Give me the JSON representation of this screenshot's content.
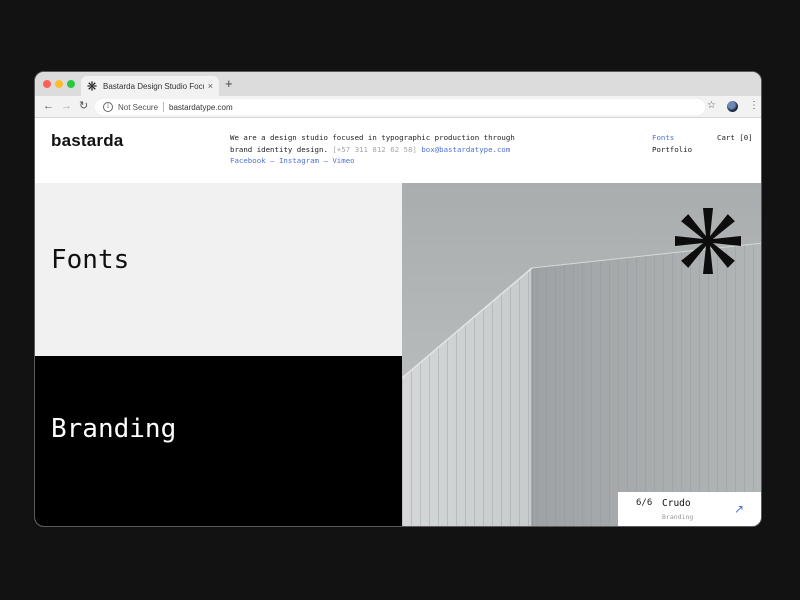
{
  "browser": {
    "tab_title": "Bastarda Design Studio Focus",
    "tab_close": "×",
    "new_tab": "+",
    "security_label": "Not Secure",
    "url": "bastardatype.com"
  },
  "site": {
    "logo": "bastarda",
    "intro_text": "We are a design studio focused in typographic production through brand identity design.",
    "phone": "[+57 311 812 62 58]",
    "email": "box@bastardatype.com",
    "social": "Facebook – Instagram – Vimeo",
    "nav": {
      "fonts": "Fonts",
      "portfolio": "Portfolio",
      "cart": "Cart [0]"
    }
  },
  "panels": {
    "fonts": "Fonts",
    "branding": "Branding"
  },
  "hero": {
    "counter": "6/6",
    "title": "Crudo",
    "subtitle": "Branding"
  },
  "colors": {
    "accent_link": "#4f72d6",
    "page_background": "#121212",
    "fonts_panel": "#f1f1f1",
    "branding_panel": "#000000"
  },
  "icons": {
    "favicon": "asterisk-icon",
    "info": "info-icon",
    "bookmark": "star-icon",
    "profile": "profile-icon",
    "menu": "menu-icon",
    "hero_mark": "asterisk-icon",
    "caption_link": "arrow-up-right-icon"
  }
}
